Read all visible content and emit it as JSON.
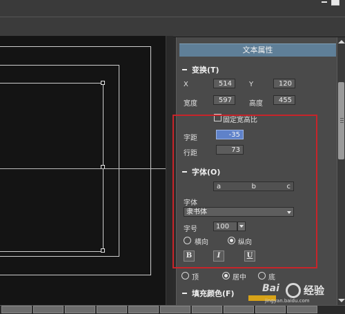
{
  "panel": {
    "title": "文本属性",
    "transform": {
      "header": "变换(T)",
      "x_label": "X",
      "x_value": "514",
      "y_label": "Y",
      "y_value": "120",
      "width_label": "宽度",
      "width_value": "597",
      "height_label": "高度",
      "height_value": "455",
      "lock_ratio_label": "固定宽高比"
    },
    "spacing": {
      "char_spacing_label": "字距",
      "char_spacing_value": "-35",
      "line_spacing_label": "行距",
      "line_spacing_value": "73"
    },
    "font": {
      "header": "字体(O)",
      "sample_chars": [
        "a",
        "b",
        "c"
      ],
      "font_label": "字体",
      "font_value": "隶书体",
      "size_label": "字号",
      "size_value": "100",
      "orientation_horizontal": "横向",
      "orientation_vertical": "纵向",
      "orientation_selected": "纵向",
      "bold": "B",
      "italic": "I",
      "underline": "U"
    },
    "align": {
      "top": "顶",
      "center": "居中",
      "bottom": "底",
      "selected": "居中"
    },
    "fill": {
      "header": "填充颜色(F)"
    }
  },
  "watermark": {
    "left": "Bai",
    "right": "经验",
    "url": "jingyan.baidu.com"
  },
  "colors": {
    "panel_bg": "#4a4a4a",
    "title_bar": "#5f7f98",
    "canvas_bg": "#141414",
    "highlight_box": "#c8242a",
    "selected_field": "#5f82c9"
  }
}
